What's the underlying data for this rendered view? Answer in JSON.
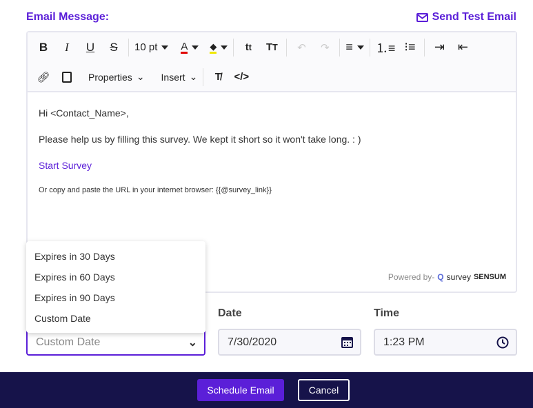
{
  "title": "Email Message:",
  "send_test": "Send Test Email",
  "toolbar": {
    "font_size": "10 pt",
    "properties": "Properties",
    "insert": "Insert",
    "font_color": "#e00000",
    "highlight_color": "#f0e800"
  },
  "body": {
    "greeting": "Hi <Contact_Name>,",
    "message": "Please help us by filling this survey. We kept it short so it won't take long. : )",
    "link": "Start Survey",
    "url_line": "Or copy and paste the URL in your internet browser: {{@survey_link}}"
  },
  "powered": {
    "prefix": "Powered by-",
    "brand_a": "survey",
    "brand_b": "SENSUM"
  },
  "expiry": {
    "selected": "Custom Date",
    "options": [
      "Expires in 30 Days",
      "Expires in 60 Days",
      "Expires in 90 Days",
      "Custom Date"
    ]
  },
  "date": {
    "label": "Date",
    "value": "7/30/2020"
  },
  "time": {
    "label": "Time",
    "value": "1:23 PM"
  },
  "footer": {
    "schedule": "Schedule Email",
    "cancel": "Cancel"
  },
  "colors": {
    "accent": "#5b1fd8",
    "footer": "#16134a"
  }
}
